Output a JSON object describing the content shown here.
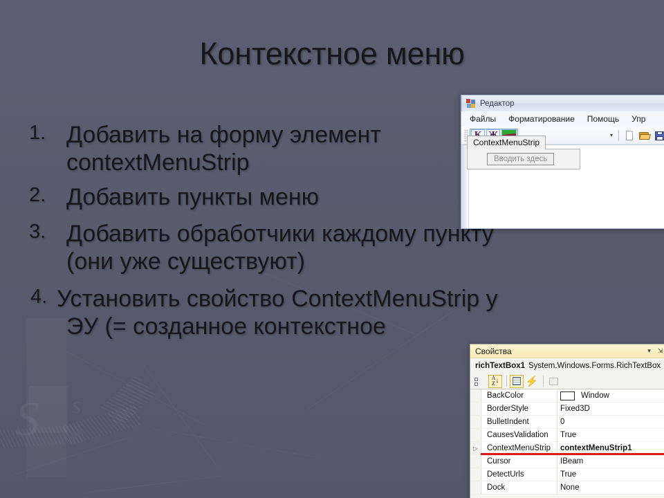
{
  "slide": {
    "title": "Контекстное меню",
    "bullets": [
      {
        "num": "1.",
        "lines": [
          "Добавить на форму элемент",
          "contextMenuStrip"
        ]
      },
      {
        "num": "2.",
        "lines": [
          "Добавить пункты меню"
        ]
      },
      {
        "num": "3.",
        "lines": [
          "Добавить обработчики каждому пункту",
          "(они уже существуют)"
        ]
      },
      {
        "num": "4.",
        "lines": [
          "Установить свойство ContextMenuStrip у",
          "ЭУ  (= созданное контекстное"
        ]
      }
    ],
    "background_color": "#585c6e",
    "text_color": "#17171b"
  },
  "editor_window": {
    "title": "Редактор",
    "app_icon": "app-form-icon",
    "menu": [
      {
        "label": "Файлы"
      },
      {
        "label": "Форматирование"
      },
      {
        "label": "Помощь"
      },
      {
        "label": "Упр"
      }
    ],
    "toolstrip": {
      "grip": "drag-grip",
      "buttons": [
        {
          "name": "italic-button",
          "label": "К"
        },
        {
          "name": "bold-button",
          "label": "Ж"
        },
        {
          "name": "color-swatch-button",
          "label": "",
          "color": "#2fa82f",
          "band_color": "#8d1638"
        }
      ],
      "overflow": "▾",
      "icons": [
        {
          "name": "new-file-icon"
        },
        {
          "name": "open-folder-icon"
        },
        {
          "name": "save-icon"
        }
      ]
    },
    "designer": {
      "tab_label": "ContextMenuStrip",
      "placeholder": "Вводить здесь"
    }
  },
  "properties_window": {
    "title": "Свойства",
    "titlebar_icons": [
      {
        "name": "chevron-down-icon",
        "glyph": "▾"
      },
      {
        "name": "pin-icon",
        "glyph": "⇲"
      }
    ],
    "object_name": "richTextBox1",
    "object_type": "System.Windows.Forms.RichTextBox",
    "toolbar": [
      {
        "name": "categorized-button",
        "active": false
      },
      {
        "name": "alphabetical-sort-button",
        "active": true
      },
      {
        "name": "properties-button",
        "active": true
      },
      {
        "name": "events-button",
        "active": false
      },
      {
        "name": "property-pages-button",
        "active": false,
        "disabled": true
      }
    ],
    "rows": [
      {
        "name": "BackColor",
        "value": "Window",
        "swatch": "#ffffff",
        "expandable": false,
        "bold": false,
        "highlight": false
      },
      {
        "name": "BorderStyle",
        "value": "Fixed3D",
        "expandable": false,
        "bold": false,
        "highlight": false
      },
      {
        "name": "BulletIndent",
        "value": "0",
        "expandable": false,
        "bold": false,
        "highlight": false
      },
      {
        "name": "CausesValidation",
        "value": "True",
        "expandable": false,
        "bold": false,
        "highlight": false
      },
      {
        "name": "ContextMenuStrip",
        "value": "contextMenuStrip1",
        "expandable": true,
        "bold": true,
        "highlight": true
      },
      {
        "name": "Cursor",
        "value": "IBeam",
        "expandable": false,
        "bold": false,
        "highlight": false
      },
      {
        "name": "DetectUrls",
        "value": "True",
        "expandable": false,
        "bold": false,
        "highlight": false
      },
      {
        "name": "Dock",
        "value": "None",
        "expandable": false,
        "bold": false,
        "highlight": false
      }
    ],
    "highlight_color": "#e01616"
  }
}
